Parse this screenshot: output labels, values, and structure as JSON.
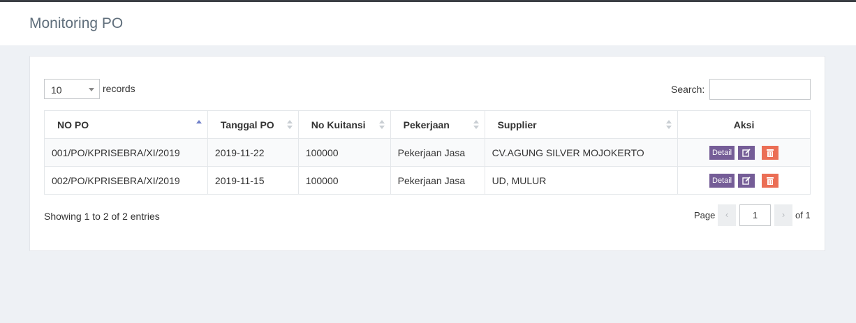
{
  "header": {
    "title": "Monitoring PO"
  },
  "length": {
    "value": "10",
    "label": "records"
  },
  "search": {
    "label": "Search:",
    "value": ""
  },
  "table": {
    "columns": [
      "NO PO",
      "Tanggal PO",
      "No Kuitansi",
      "Pekerjaan",
      "Supplier",
      "Aksi"
    ],
    "sorted_column": "NO PO",
    "sort_direction": "ascending",
    "rows": [
      {
        "no_po": "001/PO/KPRISEBRA/XI/2019",
        "tanggal_po": "2019-11-22",
        "no_kuitansi": "100000",
        "pekerjaan": "Pekerjaan Jasa",
        "supplier": "CV.AGUNG SILVER MOJOKERTO",
        "detail_label": "Detail"
      },
      {
        "no_po": "002/PO/KPRISEBRA/XI/2019",
        "tanggal_po": "2019-11-15",
        "no_kuitansi": "100000",
        "pekerjaan": "Pekerjaan Jasa",
        "supplier": "UD, MULUR",
        "detail_label": "Detail"
      }
    ]
  },
  "footer": {
    "info": "Showing 1 to 2 of 2 entries",
    "page_label": "Page",
    "prev": "‹",
    "current_page": "1",
    "next": "›",
    "of_label": "of 1"
  },
  "icons": {
    "edit": "edit-icon",
    "delete": "trash-icon",
    "caret": "chevron-down-icon"
  },
  "colors": {
    "primary_button": "#755d97",
    "danger_button": "#eb6e55",
    "sort_active": "#6f7fc9",
    "page_background": "#eef1f5"
  }
}
